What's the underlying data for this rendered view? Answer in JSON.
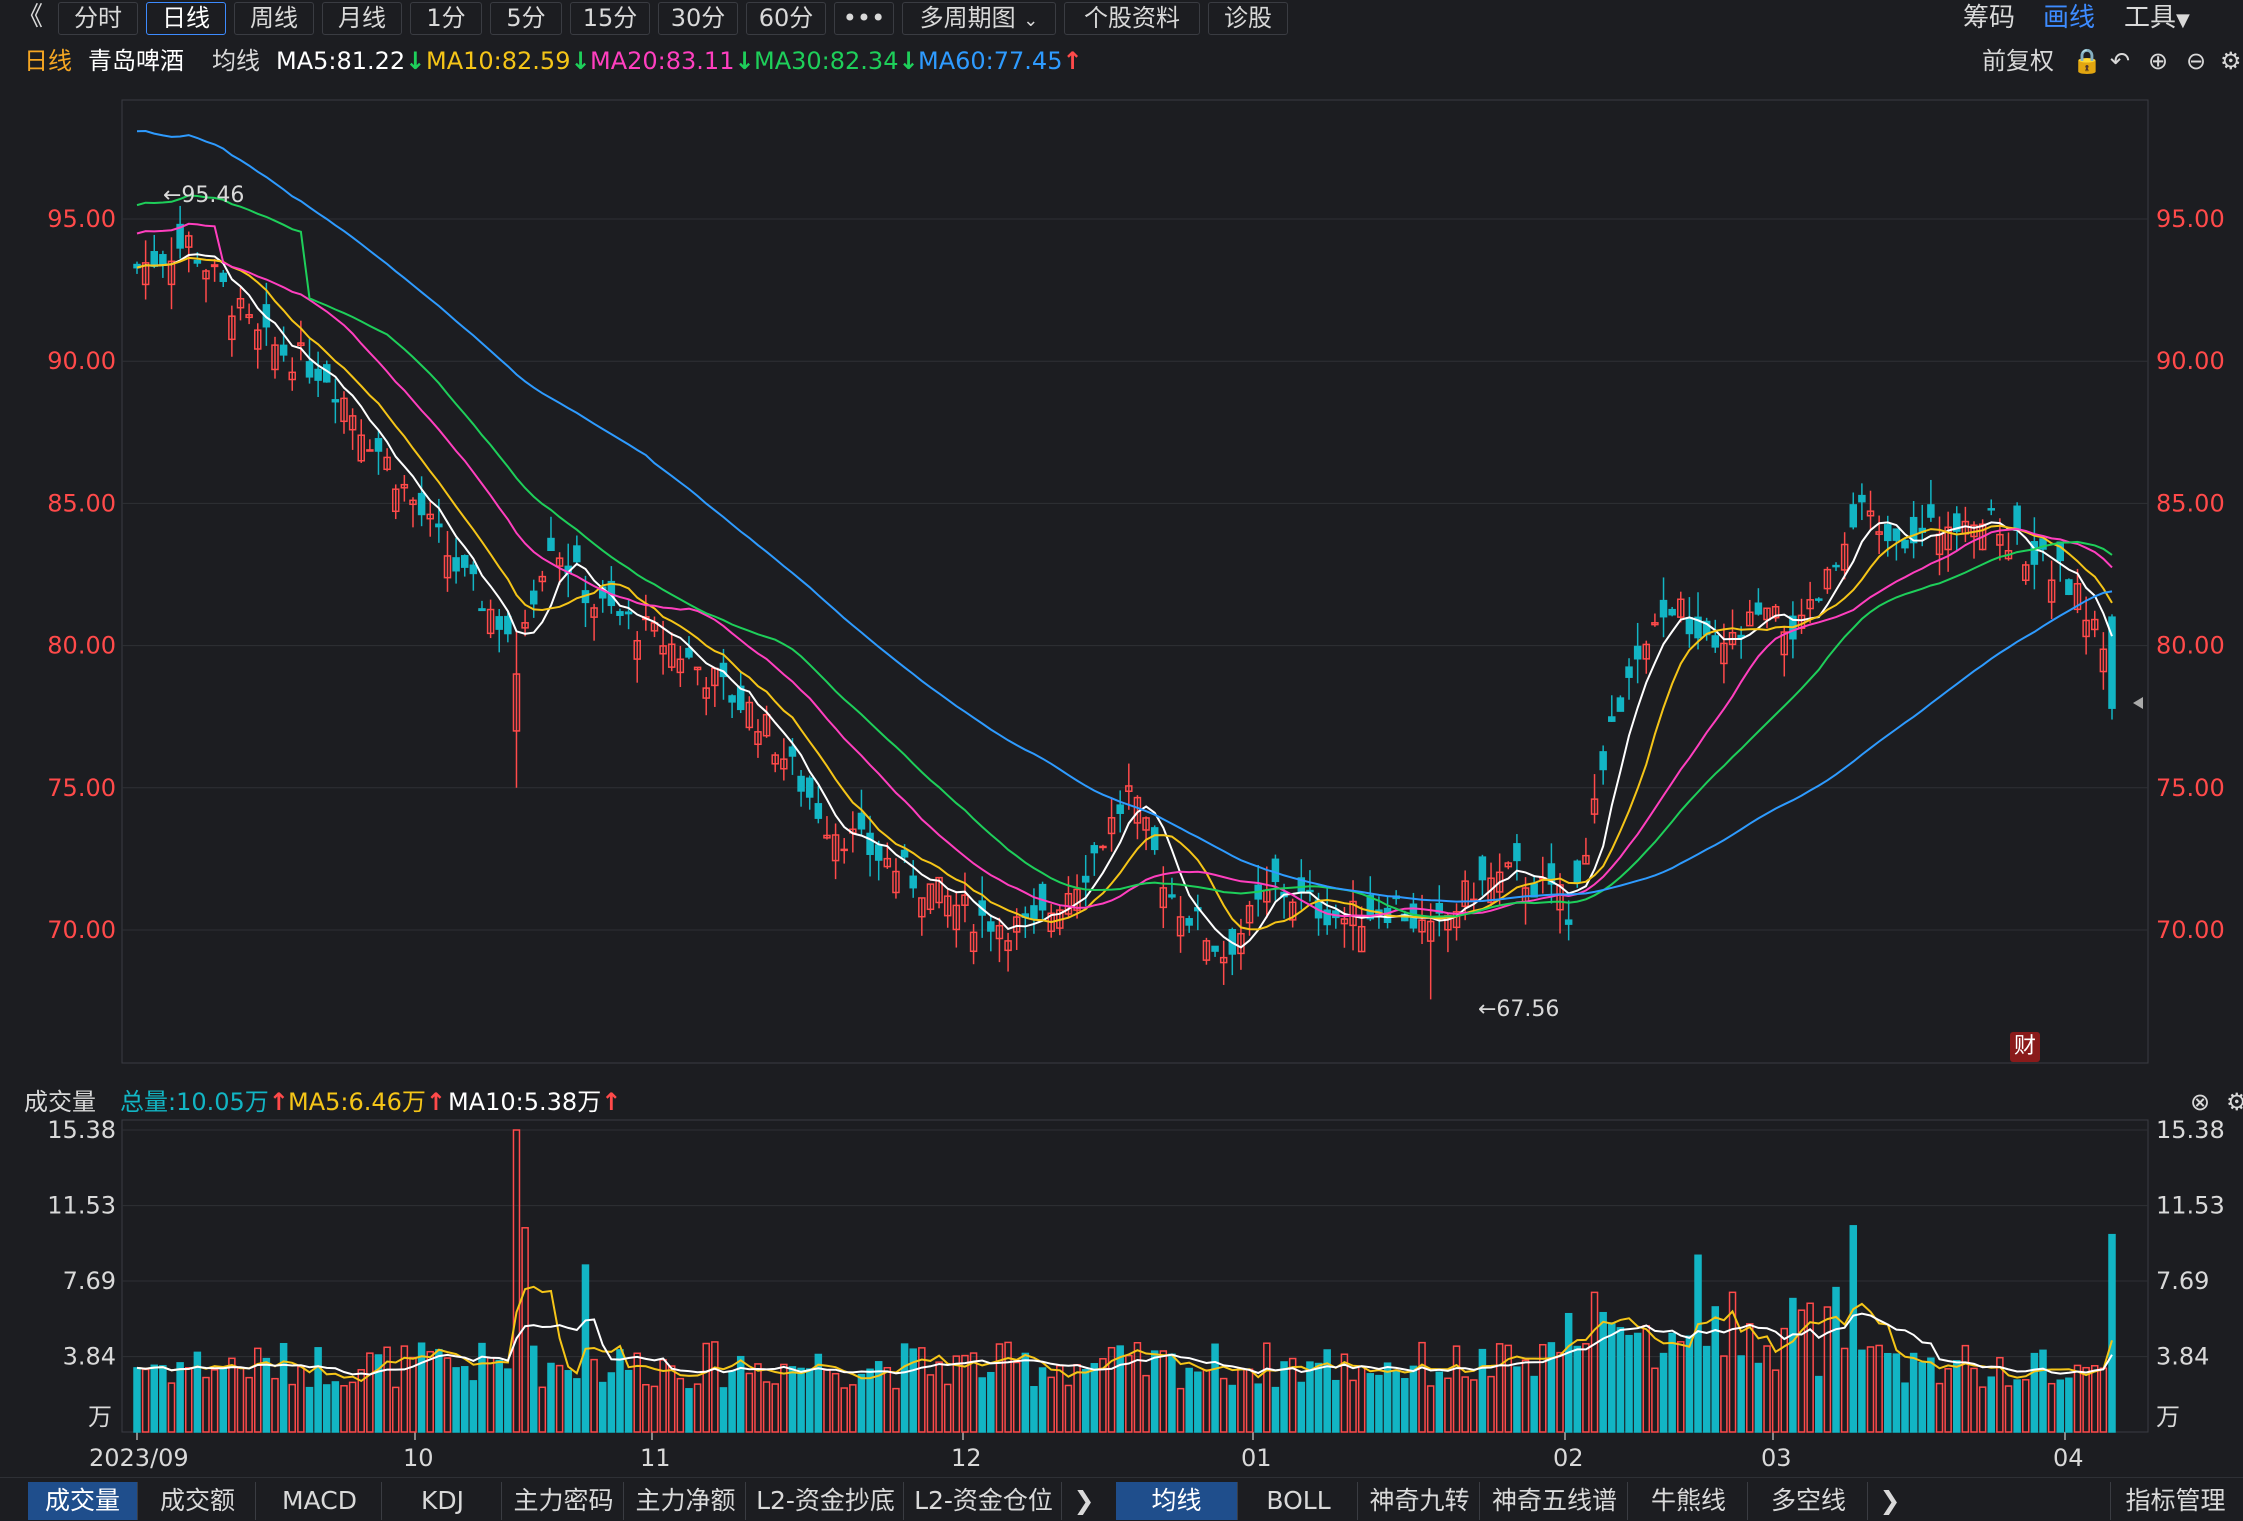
{
  "toolbar": {
    "back": "《",
    "periods": [
      "分时",
      "日线",
      "周线",
      "月线",
      "1分",
      "5分",
      "15分",
      "30分",
      "60分"
    ],
    "active_period": "日线",
    "more": "•••",
    "multi_period": "多周期图",
    "stock_info": "个股资料",
    "diagnose": "诊股",
    "right": {
      "chips": "筹码",
      "draw": "画线",
      "tools": "工具"
    }
  },
  "infobar": {
    "period": "日线",
    "stock_name": "青岛啤酒",
    "ma_label": "均线",
    "ma5": "MA5:81.22",
    "ma10": "MA10:82.59",
    "ma20": "MA20:83.11",
    "ma30": "MA30:82.34",
    "ma60": "MA60:77.45",
    "adjust": "前复权"
  },
  "colors": {
    "up": "#ff4a4a",
    "down": "#12b5c4",
    "ma5": "#ffffff",
    "ma10": "#f5c518",
    "ma20": "#ff3fbf",
    "ma30": "#1ecf5a",
    "ma60": "#2e9bff",
    "axis": "#ff4a4a"
  },
  "price_chart": {
    "annotations": {
      "high": "←95.46",
      "low": "←67.56"
    },
    "badge": "财"
  },
  "volume_panel": {
    "label": "成交量",
    "total": "总量:10.05万",
    "ma5": "MA5:6.46万",
    "ma10": "MA10:5.38万",
    "unit": "万"
  },
  "bottom_tabs_left": [
    "成交量",
    "成交额",
    "MACD",
    "KDJ",
    "主力密码",
    "主力净额",
    "L2-资金抄底",
    "L2-资金仓位"
  ],
  "bottom_tabs_right": [
    "均线",
    "BOLL",
    "神奇九转",
    "神奇五线谱",
    "牛熊线",
    "多空线"
  ],
  "indicator_manage": "指标管理",
  "chart_data": {
    "type": "candlestick",
    "title": "青岛啤酒 日线",
    "price_axis": {
      "ticks": [
        "95.00",
        "90.00",
        "85.00",
        "80.00",
        "75.00",
        "70.00"
      ],
      "ylim": [
        66,
        98
      ]
    },
    "volume_axis": {
      "ticks": [
        "15.38",
        "11.53",
        "7.69",
        "3.84"
      ],
      "unit": "万",
      "ylim": [
        0,
        15.38
      ]
    },
    "x_labels": [
      "2023/09",
      "10",
      "11",
      "12",
      "01",
      "02",
      "03",
      "04"
    ],
    "high_marker": 95.46,
    "low_marker": 67.56,
    "ma_close": {
      "MA5": 81.22,
      "MA10": 82.59,
      "MA20": 83.11,
      "MA30": 82.34,
      "MA60": 77.45
    },
    "last_volume": 10.05
  }
}
